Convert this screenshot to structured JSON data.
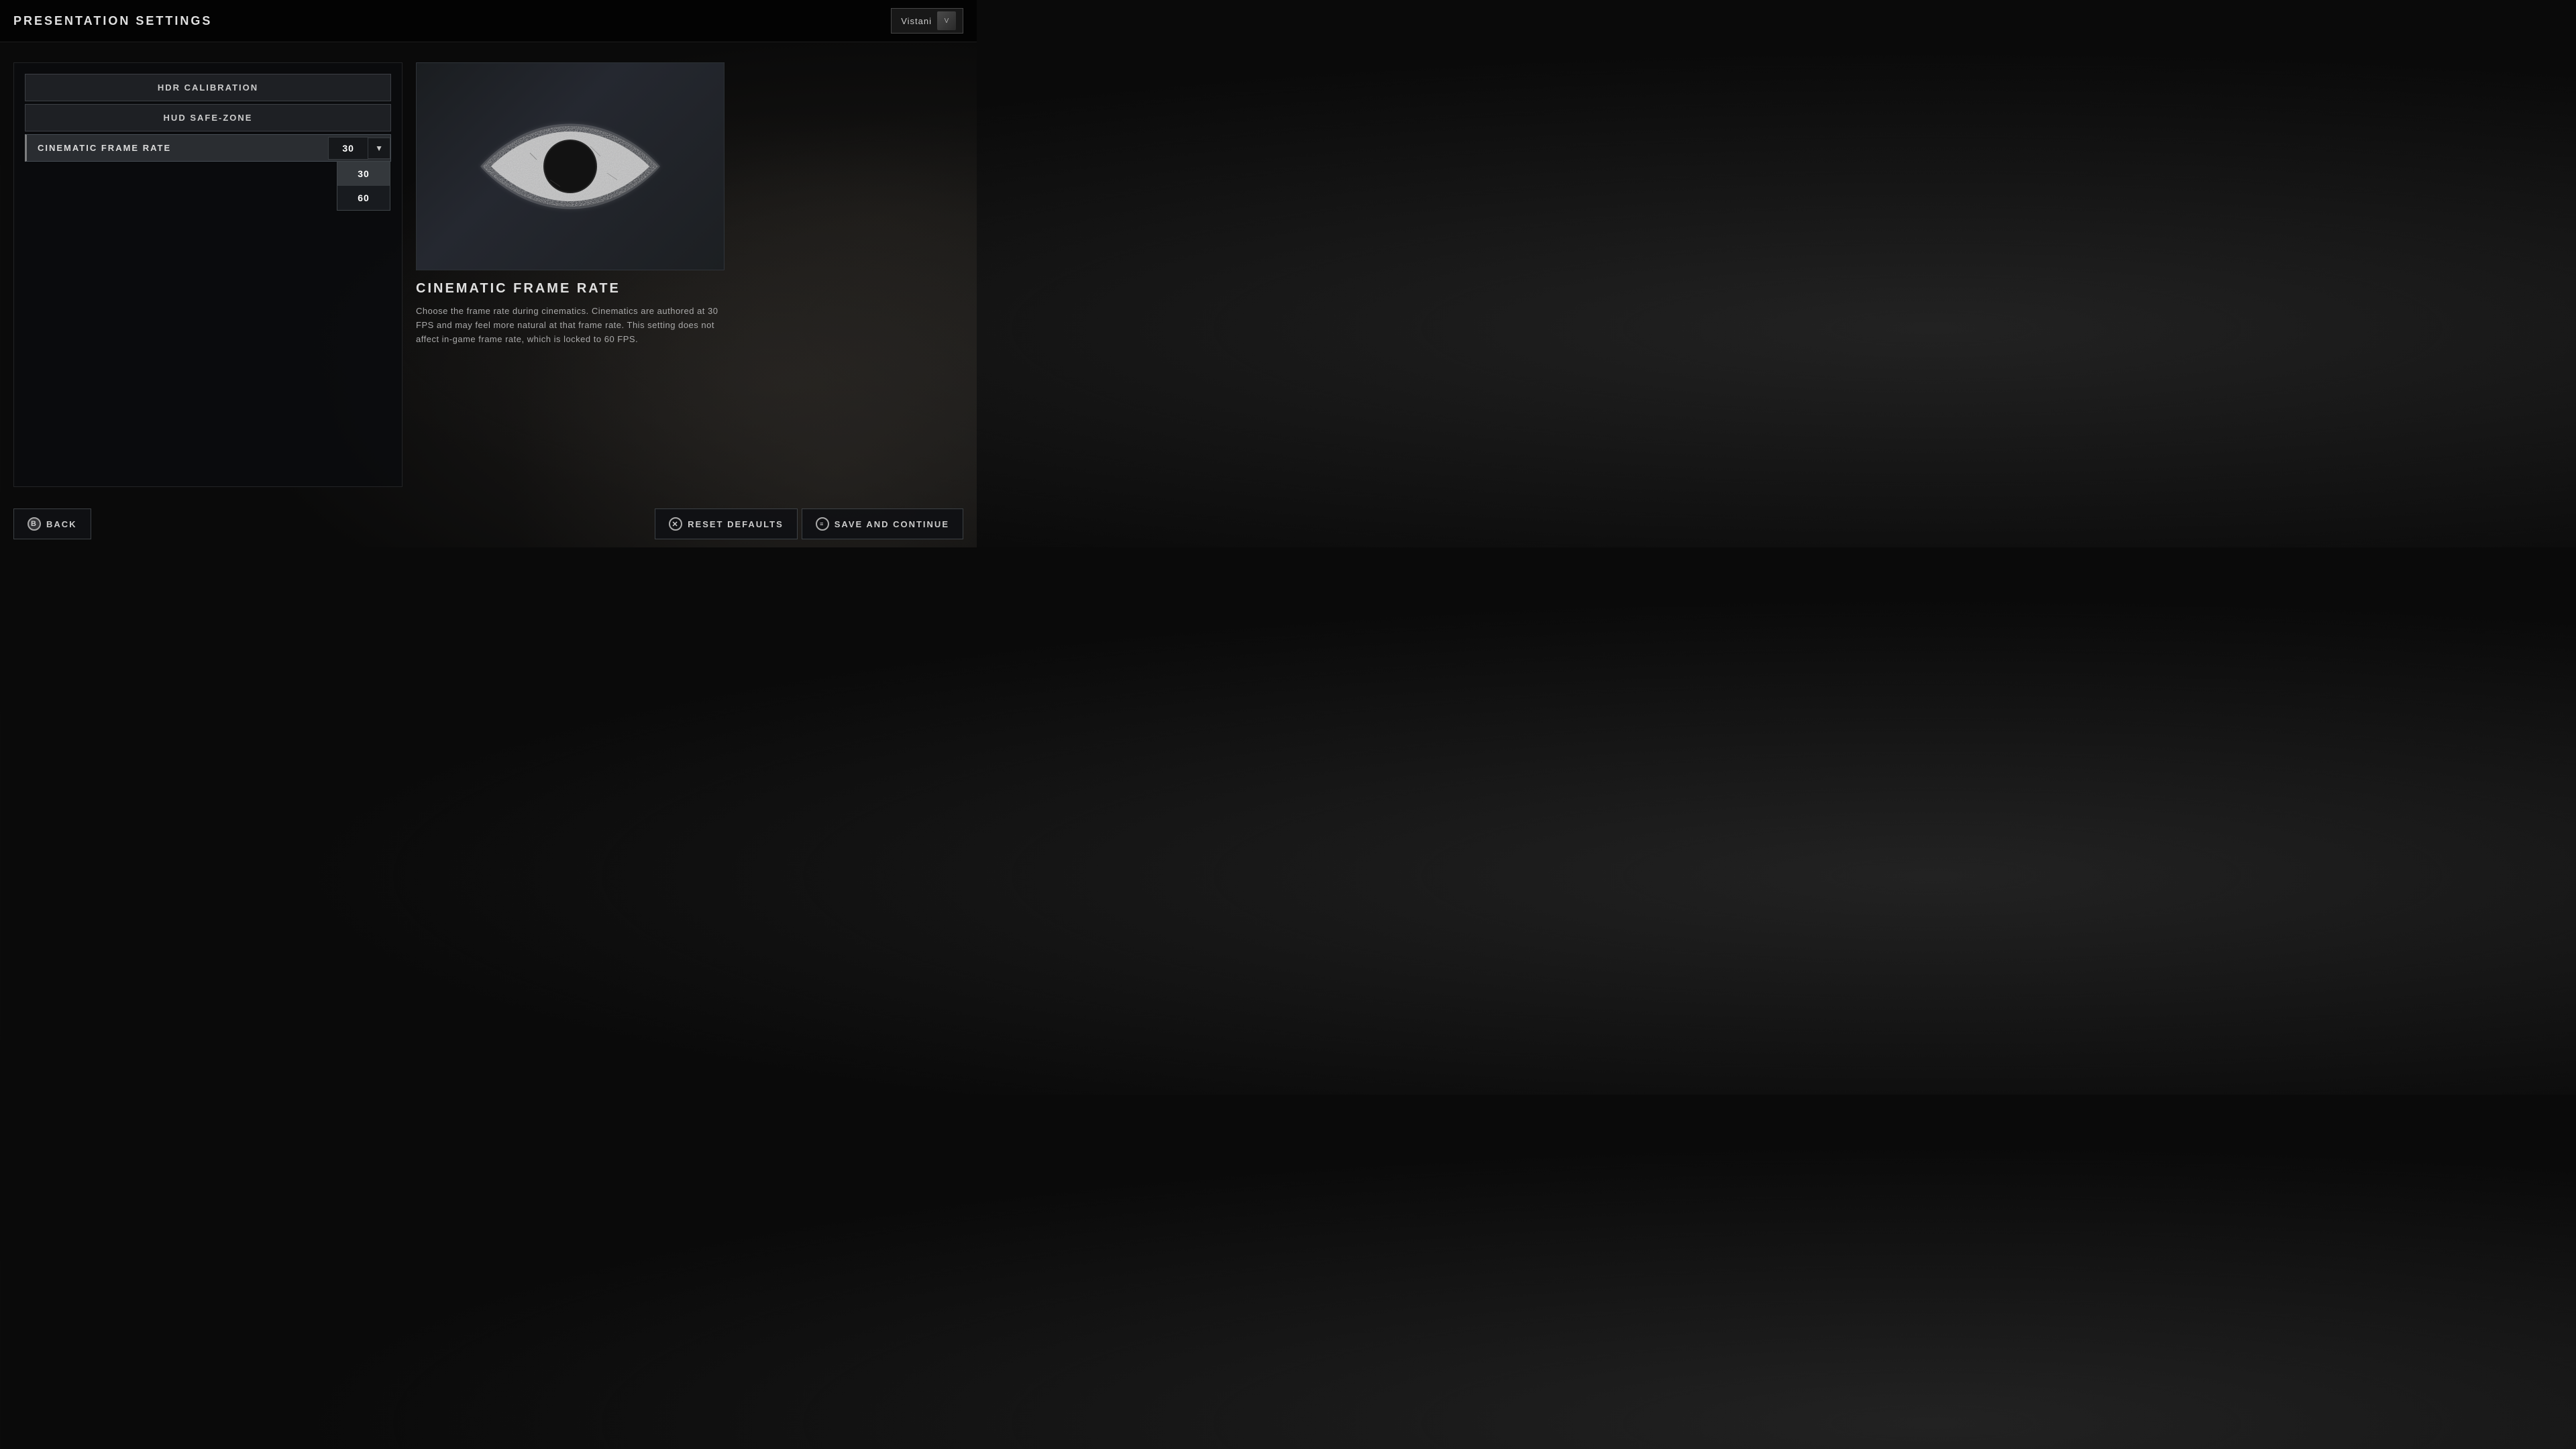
{
  "header": {
    "title": "PRESENTATION SETTINGS",
    "user": {
      "name": "Vistani",
      "avatar_label": "V"
    }
  },
  "settings_panel": {
    "buttons": [
      {
        "id": "hdr",
        "label": "HDR CALIBRATION"
      },
      {
        "id": "hud",
        "label": "HUD SAFE-ZONE"
      }
    ],
    "active_setting": {
      "label": "CINEMATIC FRAME RATE",
      "value": "30",
      "dropdown_open": true,
      "options": [
        {
          "value": "30",
          "selected": true
        },
        {
          "value": "60",
          "selected": false
        }
      ]
    }
  },
  "preview": {
    "icon_alt": "eye icon",
    "title": "CINEMATIC FRAME RATE",
    "description": "Choose the frame rate during cinematics. Cinematics are authored at 30 FPS and may feel more natural at that frame rate. This setting does not affect in-game frame rate, which is locked to 60 FPS."
  },
  "footer": {
    "back_button": "BACK",
    "back_icon": "B",
    "reset_button": "RESET DEFAULTS",
    "reset_icon": "✕",
    "save_button": "SAVE AND CONTINUE",
    "save_icon": "≡"
  }
}
